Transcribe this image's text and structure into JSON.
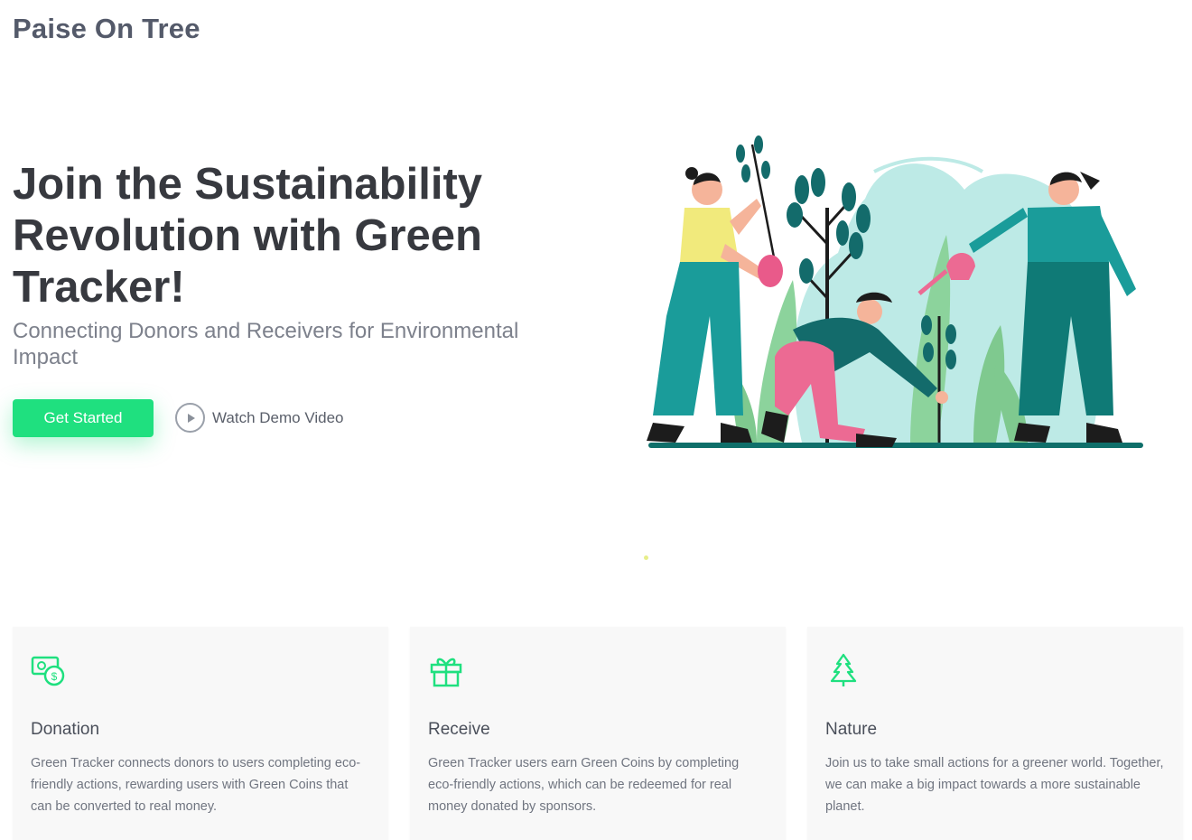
{
  "brand": {
    "name": "Paise On Tree"
  },
  "hero": {
    "title": "Join the Sustainability Revolution with Green Tracker!",
    "subtitle": "Connecting Donors and Receivers for Environmental Impact",
    "cta_label": "Get Started",
    "demo_label": "Watch Demo Video"
  },
  "features": [
    {
      "icon": "money-icon",
      "title": "Donation",
      "text": "Green Tracker connects donors to users completing eco-friendly actions, rewarding users with Green Coins that can be converted to real money."
    },
    {
      "icon": "gift-icon",
      "title": "Receive",
      "text": "Green Tracker users earn Green Coins by completing eco-friendly actions, which can be redeemed for real money donated by sponsors."
    },
    {
      "icon": "tree-icon",
      "title": "Nature",
      "text": "Join us to take small actions for a greener world. Together, we can make a big impact towards a more sustainable planet."
    }
  ],
  "colors": {
    "accent": "#1fe07f",
    "heading": "#37393f",
    "muted": "#7d818c",
    "card_bg": "#f8f8f8"
  }
}
